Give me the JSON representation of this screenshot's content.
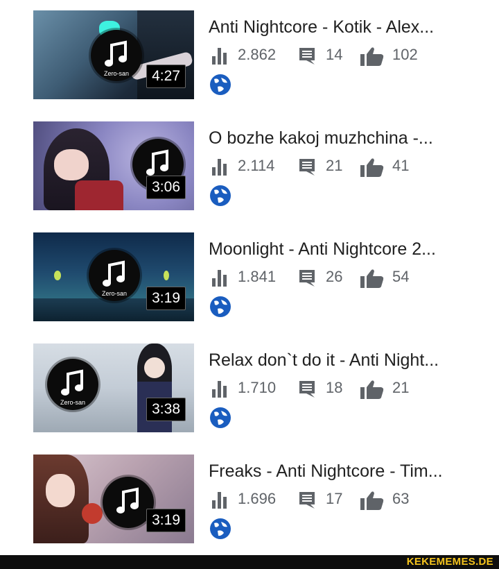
{
  "videos": [
    {
      "title": "Anti Nightcore - Kotik - Alex...",
      "duration": "4:27",
      "views": "2.862",
      "comments": "14",
      "likes": "102"
    },
    {
      "title": "O bozhe kakoj muzhchina -...",
      "duration": "3:06",
      "views": "2.114",
      "comments": "21",
      "likes": "41"
    },
    {
      "title": "Moonlight - Anti Nightcore 2...",
      "duration": "3:19",
      "views": "1.841",
      "comments": "26",
      "likes": "54"
    },
    {
      "title": "Relax don`t do it - Anti Night...",
      "duration": "3:38",
      "views": "1.710",
      "comments": "18",
      "likes": "21"
    },
    {
      "title": "Freaks - Anti Nightcore - Tim...",
      "duration": "3:19",
      "views": "1.696",
      "comments": "17",
      "likes": "63"
    }
  ],
  "thumbnail_logo_text": "Zero-san",
  "footer": {
    "watermark": "KEKEMEMES.DE"
  },
  "icons": {
    "views": "bar-chart-icon",
    "comments": "comment-icon",
    "likes": "thumbs-up-icon",
    "visibility": "globe-icon"
  },
  "colors": {
    "globe": "#1a5dbf",
    "icon_gray": "#5f6368",
    "title": "#212121",
    "watermark": "#f4c31d"
  }
}
